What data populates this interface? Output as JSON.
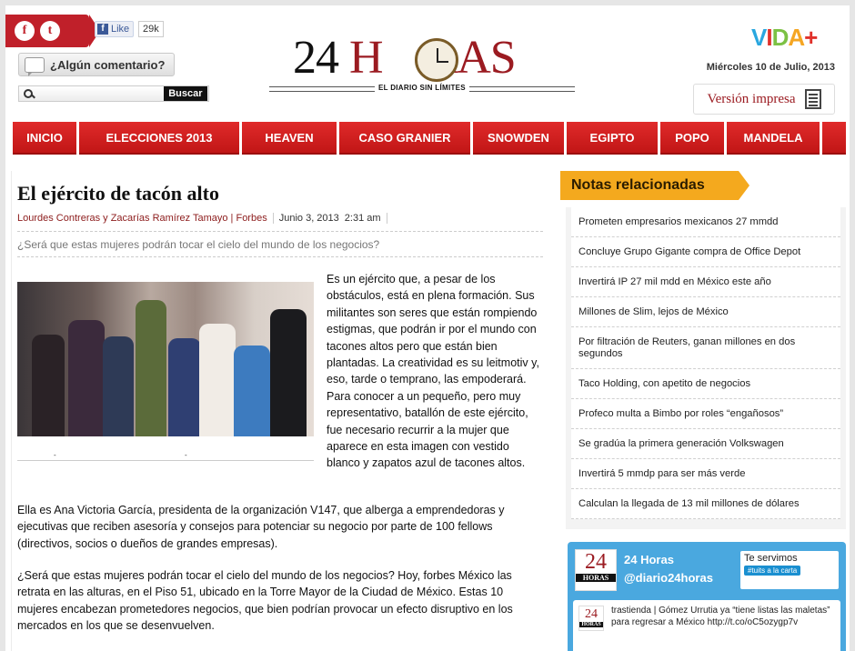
{
  "header": {
    "facebook_icon": "f",
    "twitter_icon": "t",
    "fb_like_label": "Like",
    "fb_like_count": "29k",
    "comment_label": "¿Algún comentario?",
    "search_placeholder": "",
    "search_button": "Buscar",
    "logo_prefix": "24",
    "logo_h": "H",
    "logo_suffix": "RAS",
    "tagline": "EL DIARIO SIN LÍMITES",
    "vida_v": "V",
    "vida_i": "I",
    "vida_d": "D",
    "vida_a": "A",
    "vida_plus": "+",
    "date": "Miércoles 10 de Julio, 2013",
    "print_label": "Versión impresa"
  },
  "nav": {
    "items": [
      "INICIO",
      "ELECCIONES 2013",
      "HEAVEN",
      "CASO GRANIER",
      "SNOWDEN",
      "EGIPTO",
      "POPO",
      "MANDELA"
    ]
  },
  "article": {
    "title": "El ejército de tacón alto",
    "authors": "Lourdes Contreras y Zacarías Ramírez Tamayo | Forbes",
    "date": "Junio 3, 2013",
    "time": "2:31 am",
    "subtitle": "¿Será que estas mujeres podrán tocar el cielo del mundo de los negocios?",
    "intro": "Es un ejército que, a pesar de los obstáculos, está en plena formación. Sus militantes son seres que están rompiendo estigmas, que podrán ir por el mundo con tacones altos pero que están bien plantadas. La creatividad es su leitmotiv y, eso, tarde o temprano, las empoderará. Para conocer a un pequeño, pero muy representativo, batallón de este ejército, fue necesario recurrir a la mujer que aparece en esta imagen con vestido blanco y zapatos azul de tacones altos.",
    "para1": "Ella es Ana Victoria García, presidenta de la organización V147, que alberga a emprendedoras y ejecutivas que reciben asesoría y consejos para potenciar su negocio por parte de 100 fellows (directivos, socios o dueños de grandes empresas).",
    "para2": "¿Será que estas mujeres podrán tocar el cielo del mundo de los negocios? Hoy, forbes México las retrata en las alturas, en el Piso 51, ubicado en la Torre Mayor de la Ciudad de México. Estas 10 mujeres encabezan prometedores negocios, que bien podrían provocar un efecto disruptivo en los mercados en los que se desenvuelven."
  },
  "related": {
    "heading": "Notas relacionadas",
    "items": [
      "Prometen empresarios mexicanos 27 mmdd",
      "Concluye Grupo Gigante compra de Office Depot",
      "Invertirá IP 27 mil mdd en México este año",
      "Millones de Slim, lejos de México",
      "Por filtración de Reuters, ganan millones en dos segundos",
      "Taco Holding, con apetito de negocios",
      "Profeco multa a Bimbo por roles “engañosos”",
      "Se gradúa la primera generación Volkswagen",
      "Invertirá 5 mmdp para ser más verde",
      "Calculan la llegada de 13 mil millones de dólares"
    ]
  },
  "twitter": {
    "logo_number": "24",
    "logo_word": "HORAS",
    "name": "24 Horas",
    "handle": "@diario24horas",
    "badge_title": "Te servimos",
    "badge_pill": "#tuits a la carta",
    "tweet": "trastienda | Gómez Urrutia ya “tiene listas las maletas” para regresar a México http://t.co/oC5ozygp7v"
  },
  "colors": {
    "brand_red": "#c11616",
    "logo_red": "#9b1b21",
    "accent_orange": "#f4a91e",
    "twitter_blue": "#4aa8df"
  }
}
